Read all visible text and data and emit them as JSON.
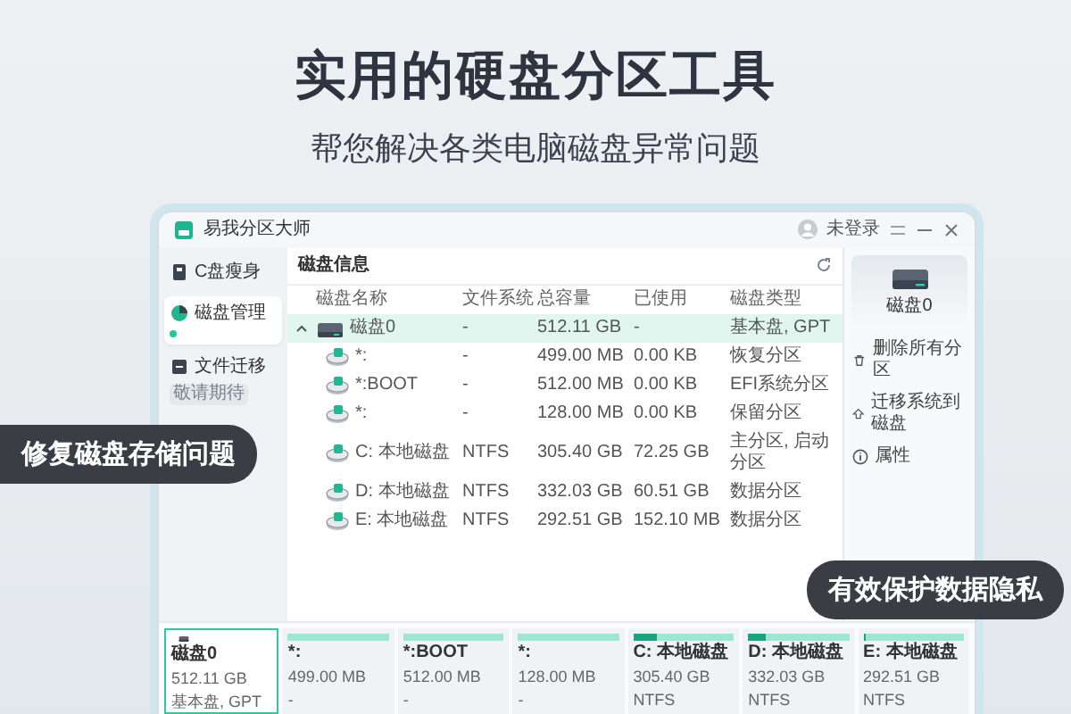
{
  "headline": "实用的硬盘分区工具",
  "subheadline": "帮您解决各类电脑磁盘异常问题",
  "window": {
    "title": "易我分区大师",
    "user": "未登录"
  },
  "sidebar": {
    "items": [
      {
        "label": "C盘瘦身",
        "selected": false
      },
      {
        "label": "磁盘管理",
        "selected": true
      },
      {
        "label": "文件迁移",
        "selected": false,
        "badge": "敬请期待"
      }
    ]
  },
  "panel": {
    "title": "磁盘信息"
  },
  "table": {
    "columns": [
      "磁盘名称",
      "文件系统",
      "总容量",
      "已使用",
      "磁盘类型"
    ],
    "rows": [
      {
        "kind": "disk",
        "expanded": true,
        "selected": true,
        "cells": [
          "磁盘0",
          "-",
          "512.11 GB",
          "-",
          "基本盘, GPT"
        ]
      },
      {
        "kind": "partition",
        "selected": false,
        "cells": [
          "*:",
          "-",
          "499.00 MB",
          "0.00 KB",
          "恢复分区"
        ]
      },
      {
        "kind": "partition",
        "selected": false,
        "cells": [
          "*:BOOT",
          "-",
          "512.00 MB",
          "0.00 KB",
          "EFI系统分区"
        ]
      },
      {
        "kind": "partition",
        "selected": false,
        "cells": [
          "*:",
          "-",
          "128.00 MB",
          "0.00 KB",
          "保留分区"
        ]
      },
      {
        "kind": "partition",
        "selected": false,
        "cells": [
          "C: 本地磁盘",
          "NTFS",
          "305.40 GB",
          "72.25 GB",
          "主分区, 启动分区"
        ]
      },
      {
        "kind": "partition",
        "selected": false,
        "cells": [
          "D: 本地磁盘",
          "NTFS",
          "332.03 GB",
          "60.51 GB",
          "数据分区"
        ]
      },
      {
        "kind": "partition",
        "selected": false,
        "cells": [
          "E: 本地磁盘",
          "NTFS",
          "292.51 GB",
          "152.10 MB",
          "数据分区"
        ]
      }
    ]
  },
  "details": {
    "disk_name": "磁盘0",
    "actions": [
      "删除所有分区",
      "迁移系统到磁盘",
      "属性"
    ]
  },
  "cards": [
    {
      "kind": "disk",
      "selected": true,
      "name": "磁盘0",
      "size": "512.11 GB",
      "note": "基本盘, GPT"
    },
    {
      "kind": "partition",
      "selected": false,
      "name": "*:",
      "size": "499.00 MB",
      "note": "-",
      "level": 0
    },
    {
      "kind": "partition",
      "selected": false,
      "name": "*:BOOT",
      "size": "512.00 MB",
      "note": "-",
      "level": 0
    },
    {
      "kind": "partition",
      "selected": false,
      "name": "*:",
      "size": "128.00 MB",
      "note": "-",
      "level": 0
    },
    {
      "kind": "partition",
      "selected": false,
      "name": "C: 本地磁盘",
      "size": "305.40 GB",
      "note": "NTFS",
      "level": 0.24
    },
    {
      "kind": "partition",
      "selected": false,
      "name": "D: 本地磁盘",
      "size": "332.03 GB",
      "note": "NTFS",
      "level": 0.18
    },
    {
      "kind": "partition",
      "selected": false,
      "name": "E: 本地磁盘",
      "size": "292.51 GB",
      "note": "NTFS",
      "level": 0.01
    }
  ],
  "callouts": [
    "修复磁盘存储问题",
    "有效保护数据隐私"
  ]
}
